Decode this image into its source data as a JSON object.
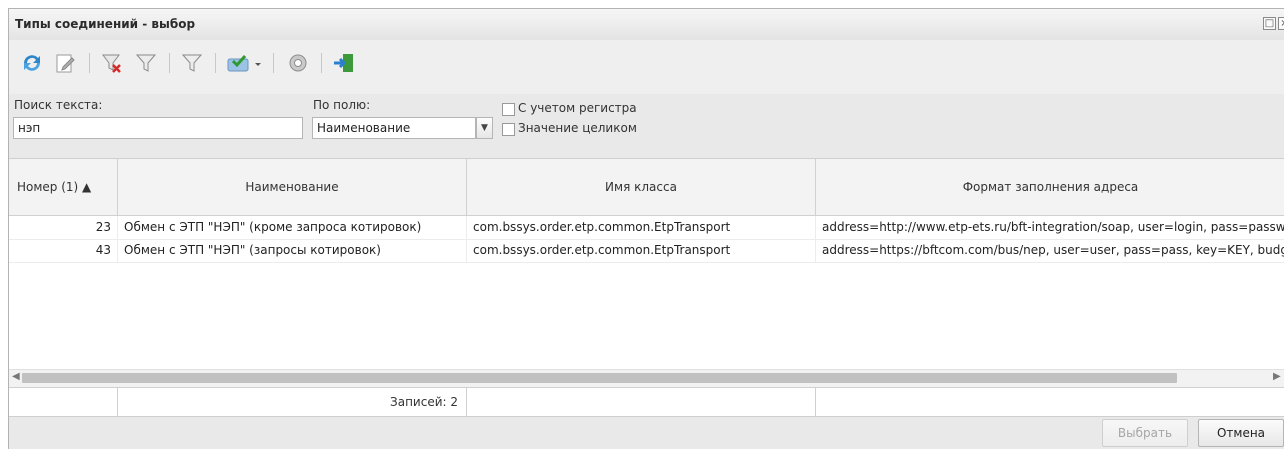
{
  "window": {
    "title": "Типы соединений - выбор"
  },
  "search": {
    "text_label": "Поиск текста:",
    "text_value": "нэп",
    "field_label": "По полю:",
    "field_value": "Наименование",
    "case_label": "С учетом регистра",
    "whole_label": "Значение целиком"
  },
  "toolbar": {
    "icons": [
      "refresh-icon",
      "edit-icon",
      "clear-filter-icon",
      "filter-icon",
      "filter-funnel-icon",
      "mark-select-icon",
      "settings-gear-icon",
      "exit-icon"
    ]
  },
  "grid": {
    "columns": [
      "Номер (1) ▲",
      "Наименование",
      "Имя класса",
      "Формат заполнения адреса"
    ],
    "rows": [
      [
        "23",
        "Обмен с ЭТП \"НЭП\" (кроме запроса котировок)",
        "com.bssys.order.etp.common.EtpTransport",
        "address=http://www.etp-ets.ru/bft-integration/soap, user=login, pass=password,"
      ],
      [
        "43",
        "Обмен с ЭТП \"НЭП\" (запросы котировок)",
        "com.bssys.order.etp.common.EtpTransport",
        "address=https://bftcom.com/bus/nep, user=user, pass=pass, key=KEY, budgetID"
      ]
    ],
    "footer_count": "Записей: 2"
  },
  "buttons": {
    "select": "Выбрать",
    "cancel": "Отмена"
  }
}
